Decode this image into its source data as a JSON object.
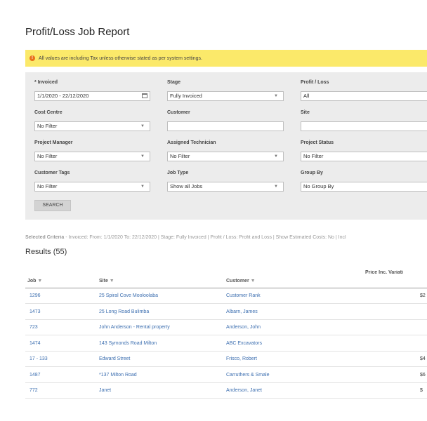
{
  "page": {
    "title": "Profit/Loss Job Report"
  },
  "alert": {
    "icon": "warning-icon",
    "text": "All values are including Tax unless otherwise stated as per system settings."
  },
  "filters": {
    "invoiced": {
      "label": "* Invoiced",
      "value": "1/1/2020 - 22/12/2020",
      "icon": "calendar-icon"
    },
    "stage": {
      "label": "Stage",
      "value": "Fully Invoiced"
    },
    "profit_loss": {
      "label": "Profit / Loss",
      "value": "All"
    },
    "cost_centre": {
      "label": "Cost Centre",
      "value": "No Filter"
    },
    "customer": {
      "label": "Customer",
      "value": ""
    },
    "site": {
      "label": "Site",
      "value": ""
    },
    "project_manager": {
      "label": "Project Manager",
      "value": "No Filter"
    },
    "assigned_technician": {
      "label": "Assigned Technician",
      "value": "No Filter"
    },
    "project_status": {
      "label": "Project Status",
      "value": "No Filter"
    },
    "customer_tags": {
      "label": "Customer Tags",
      "value": "No Filter"
    },
    "job_type": {
      "label": "Job Type",
      "value": "Show all Jobs"
    },
    "group_by": {
      "label": "Group By",
      "value": "No Group By"
    },
    "search_button": "SEARCH"
  },
  "criteria": {
    "label": "Selected Criteria",
    "text": " - Invoiced: From: 1/1/2020 To: 22/12/2020 | Stage: Fully Invoiced | Profit / Loss: Profit and Loss | Show Estimated Costs: No | Incl"
  },
  "results": {
    "title": "Results (55)",
    "columns": {
      "job": "Job",
      "site": "Site",
      "customer": "Customer",
      "price": "Price Inc. Variati",
      "sort_glyph": "▼"
    },
    "rows": [
      {
        "job": "1296",
        "site": "25 Spiral Cove Mooloolaba",
        "customer": "Customer Rank",
        "price": "$2"
      },
      {
        "job": "1473",
        "site": "25 Long Road Bulimba",
        "customer": "Albarn, James",
        "price": ""
      },
      {
        "job": "723",
        "site": "John Anderson - Rental property",
        "customer": "Anderson, John",
        "price": ""
      },
      {
        "job": "1474",
        "site": "143 Symonds Road Milton",
        "customer": "ABC Excavators",
        "price": ""
      },
      {
        "job": "17 - 133",
        "site": "Edward Street",
        "customer": "Frisco, Robert",
        "price": "$4"
      },
      {
        "job": "1487",
        "site": "*137 Milton Road",
        "customer": "Carruthers & Smale",
        "price": "$6"
      },
      {
        "job": "772",
        "site": "Janet",
        "customer": "Anderson, Janet",
        "price": "$"
      }
    ]
  }
}
